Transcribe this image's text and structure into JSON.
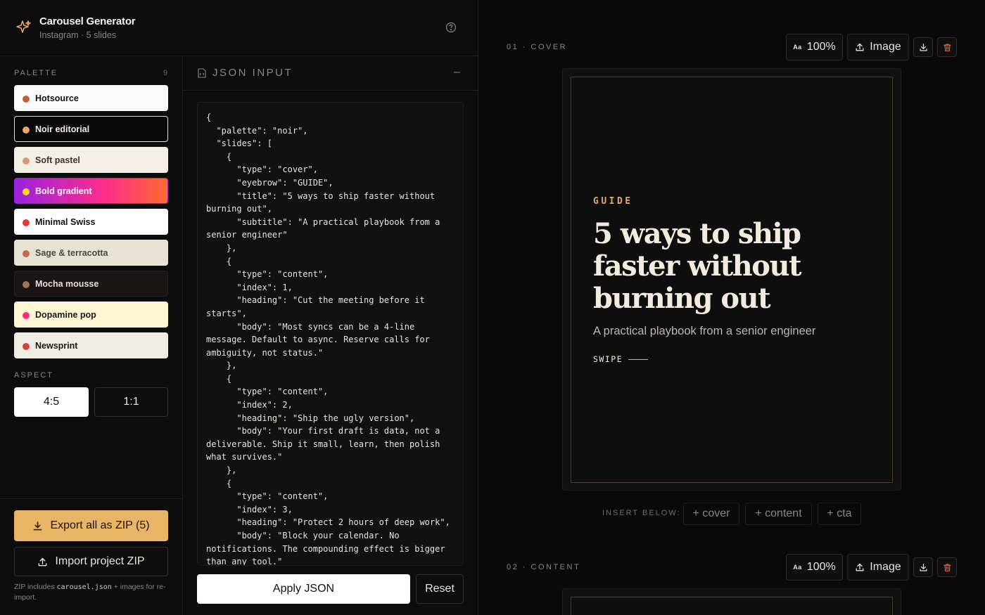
{
  "app": {
    "title": "Carousel Generator",
    "subtitle": "Instagram · 5 slides"
  },
  "palette": {
    "label": "PALETTE",
    "count": "9",
    "items": [
      {
        "label": "Hotsource",
        "bg": "#fafafa",
        "fg": "#111111",
        "dot": "#c0603a",
        "border": "#fafafa"
      },
      {
        "label": "Noir editorial",
        "bg": "#0a0a0a",
        "fg": "#f3ecdc",
        "dot": "#e8a864",
        "border": "#d9d9d9"
      },
      {
        "label": "Soft pastel",
        "bg": "#f3eee6",
        "fg": "#3a3530",
        "dot": "#d59a72",
        "border": "#f3eee6"
      },
      {
        "label": "Bold gradient",
        "bg": "linear-gradient(90deg,#9b22e0,#ff2d8a 60%,#ff6a2d)",
        "fg": "#ffffff",
        "dot": "#ffd81a",
        "border": "#9b22e0"
      },
      {
        "label": "Minimal Swiss",
        "bg": "#ffffff",
        "fg": "#111111",
        "dot": "#e53935",
        "border": "#ffffff"
      },
      {
        "label": "Sage & terracotta",
        "bg": "#e6e2d4",
        "fg": "#4a4a3a",
        "dot": "#c46b45",
        "border": "#e6e2d4"
      },
      {
        "label": "Mocha mousse",
        "bg": "#1a1615",
        "fg": "#e8ddd6",
        "dot": "#a3705a",
        "border": "#262120"
      },
      {
        "label": "Dopamine pop",
        "bg": "#fff6d6",
        "fg": "#1a1a1a",
        "dot": "#ff2d7a",
        "border": "#fff6d6"
      },
      {
        "label": "Newsprint",
        "bg": "#efece6",
        "fg": "#1a1a1a",
        "dot": "#d0453a",
        "border": "#efece6"
      }
    ]
  },
  "aspect": {
    "label": "ASPECT",
    "options": [
      "4:5",
      "1:1"
    ],
    "selected": "4:5"
  },
  "footer": {
    "export_label": "Export all as ZIP (5)",
    "import_label": "Import project ZIP",
    "note_prefix": "ZIP includes ",
    "note_code": "carousel.json",
    "note_suffix": " + images for re-import."
  },
  "json_input": {
    "title": "JSON INPUT",
    "collapse": "–",
    "text": "{\n  \"palette\": \"noir\",\n  \"slides\": [\n    {\n      \"type\": \"cover\",\n      \"eyebrow\": \"GUIDE\",\n      \"title\": \"5 ways to ship faster without burning out\",\n      \"subtitle\": \"A practical playbook from a senior engineer\"\n    },\n    {\n      \"type\": \"content\",\n      \"index\": 1,\n      \"heading\": \"Cut the meeting before it starts\",\n      \"body\": \"Most syncs can be a 4-line message. Default to async. Reserve calls for ambiguity, not status.\"\n    },\n    {\n      \"type\": \"content\",\n      \"index\": 2,\n      \"heading\": \"Ship the ugly version\",\n      \"body\": \"Your first draft is data, not a deliverable. Ship it small, learn, then polish what survives.\"\n    },\n    {\n      \"type\": \"content\",\n      \"index\": 3,\n      \"heading\": \"Protect 2 hours of deep work\",\n      \"body\": \"Block your calendar. No notifications. The compounding effect is bigger than any tool.\"\n    },",
    "apply_label": "Apply JSON",
    "reset_label": "Reset"
  },
  "slides": [
    {
      "label": "01 · COVER",
      "font_scale_tag": "Aa",
      "font_scale": "100%",
      "image_label": "Image",
      "eyebrow": "GUIDE",
      "title": "5 ways to ship faster without burning out",
      "subtitle": "A practical playbook from a senior engineer",
      "swipe": "SWIPE"
    },
    {
      "label": "02 · CONTENT",
      "font_scale_tag": "Aa",
      "font_scale": "100%",
      "image_label": "Image"
    }
  ],
  "insert": {
    "label": "INSERT BELOW:",
    "options": [
      "+ cover",
      "+ content",
      "+ cta"
    ]
  },
  "colors": {
    "accent": "#e8a864",
    "export_bg": "#e8b466",
    "danger": "#e0603a"
  }
}
